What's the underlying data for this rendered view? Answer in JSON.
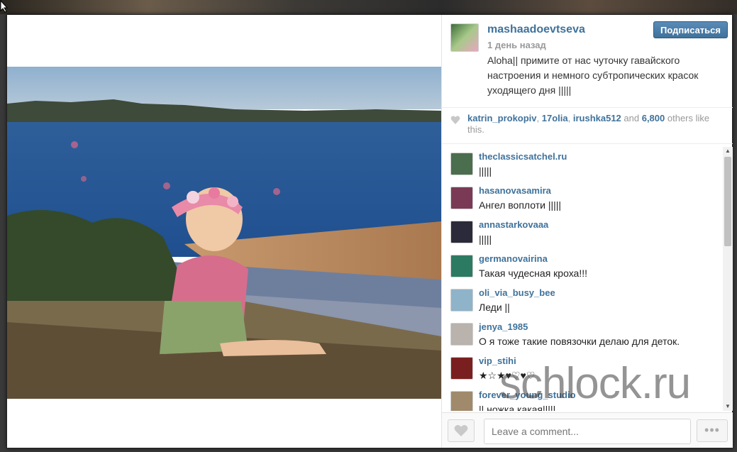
{
  "post": {
    "username": "mashaadoevtseva",
    "posted": "1 день назад",
    "caption": "Aloha|| примите от нас чуточку гавайского настроения и немного субтропических красок уходящего дня |||||",
    "follow_label": "Подписаться"
  },
  "likes": {
    "names": [
      "katrin_prokopiv",
      "17olia",
      "irushka512"
    ],
    "sep1": ", ",
    "sep2": ", ",
    "and": " and ",
    "count": "6,800",
    "suffix": " others like this."
  },
  "comments": [
    {
      "user": "theclassicsatchel.ru",
      "text": "|||||",
      "avatar_color": "#4b6e4e"
    },
    {
      "user": "hasanovasamira",
      "text": "Ангел воплоти |||||",
      "avatar_color": "#7a3a55"
    },
    {
      "user": "annastarkovaaa",
      "text": "|||||",
      "avatar_color": "#2a2a3a"
    },
    {
      "user": "germanovairina",
      "text": "Такая чудесная кроха!!!",
      "avatar_color": "#2d7a62"
    },
    {
      "user": "oli_via_busy_bee",
      "text": "Леди ||",
      "avatar_color": "#8fb3c9"
    },
    {
      "user": "jenya_1985",
      "text": "О я тоже такие повязочки делаю для деток.",
      "avatar_color": "#b9b2ad"
    },
    {
      "user": "vip_stihi",
      "text": "★☆★♥♡♥♡",
      "avatar_color": "#7a1f1f"
    },
    {
      "user": "forever_young_studio",
      "text": "|| ножка какая|||||",
      "avatar_color": "#a08a6b"
    }
  ],
  "footer": {
    "comment_placeholder": "Leave a comment..."
  },
  "watermark": "schlock.ru",
  "colors": {
    "link": "#3f729b",
    "follow_button": "#3f729b"
  }
}
